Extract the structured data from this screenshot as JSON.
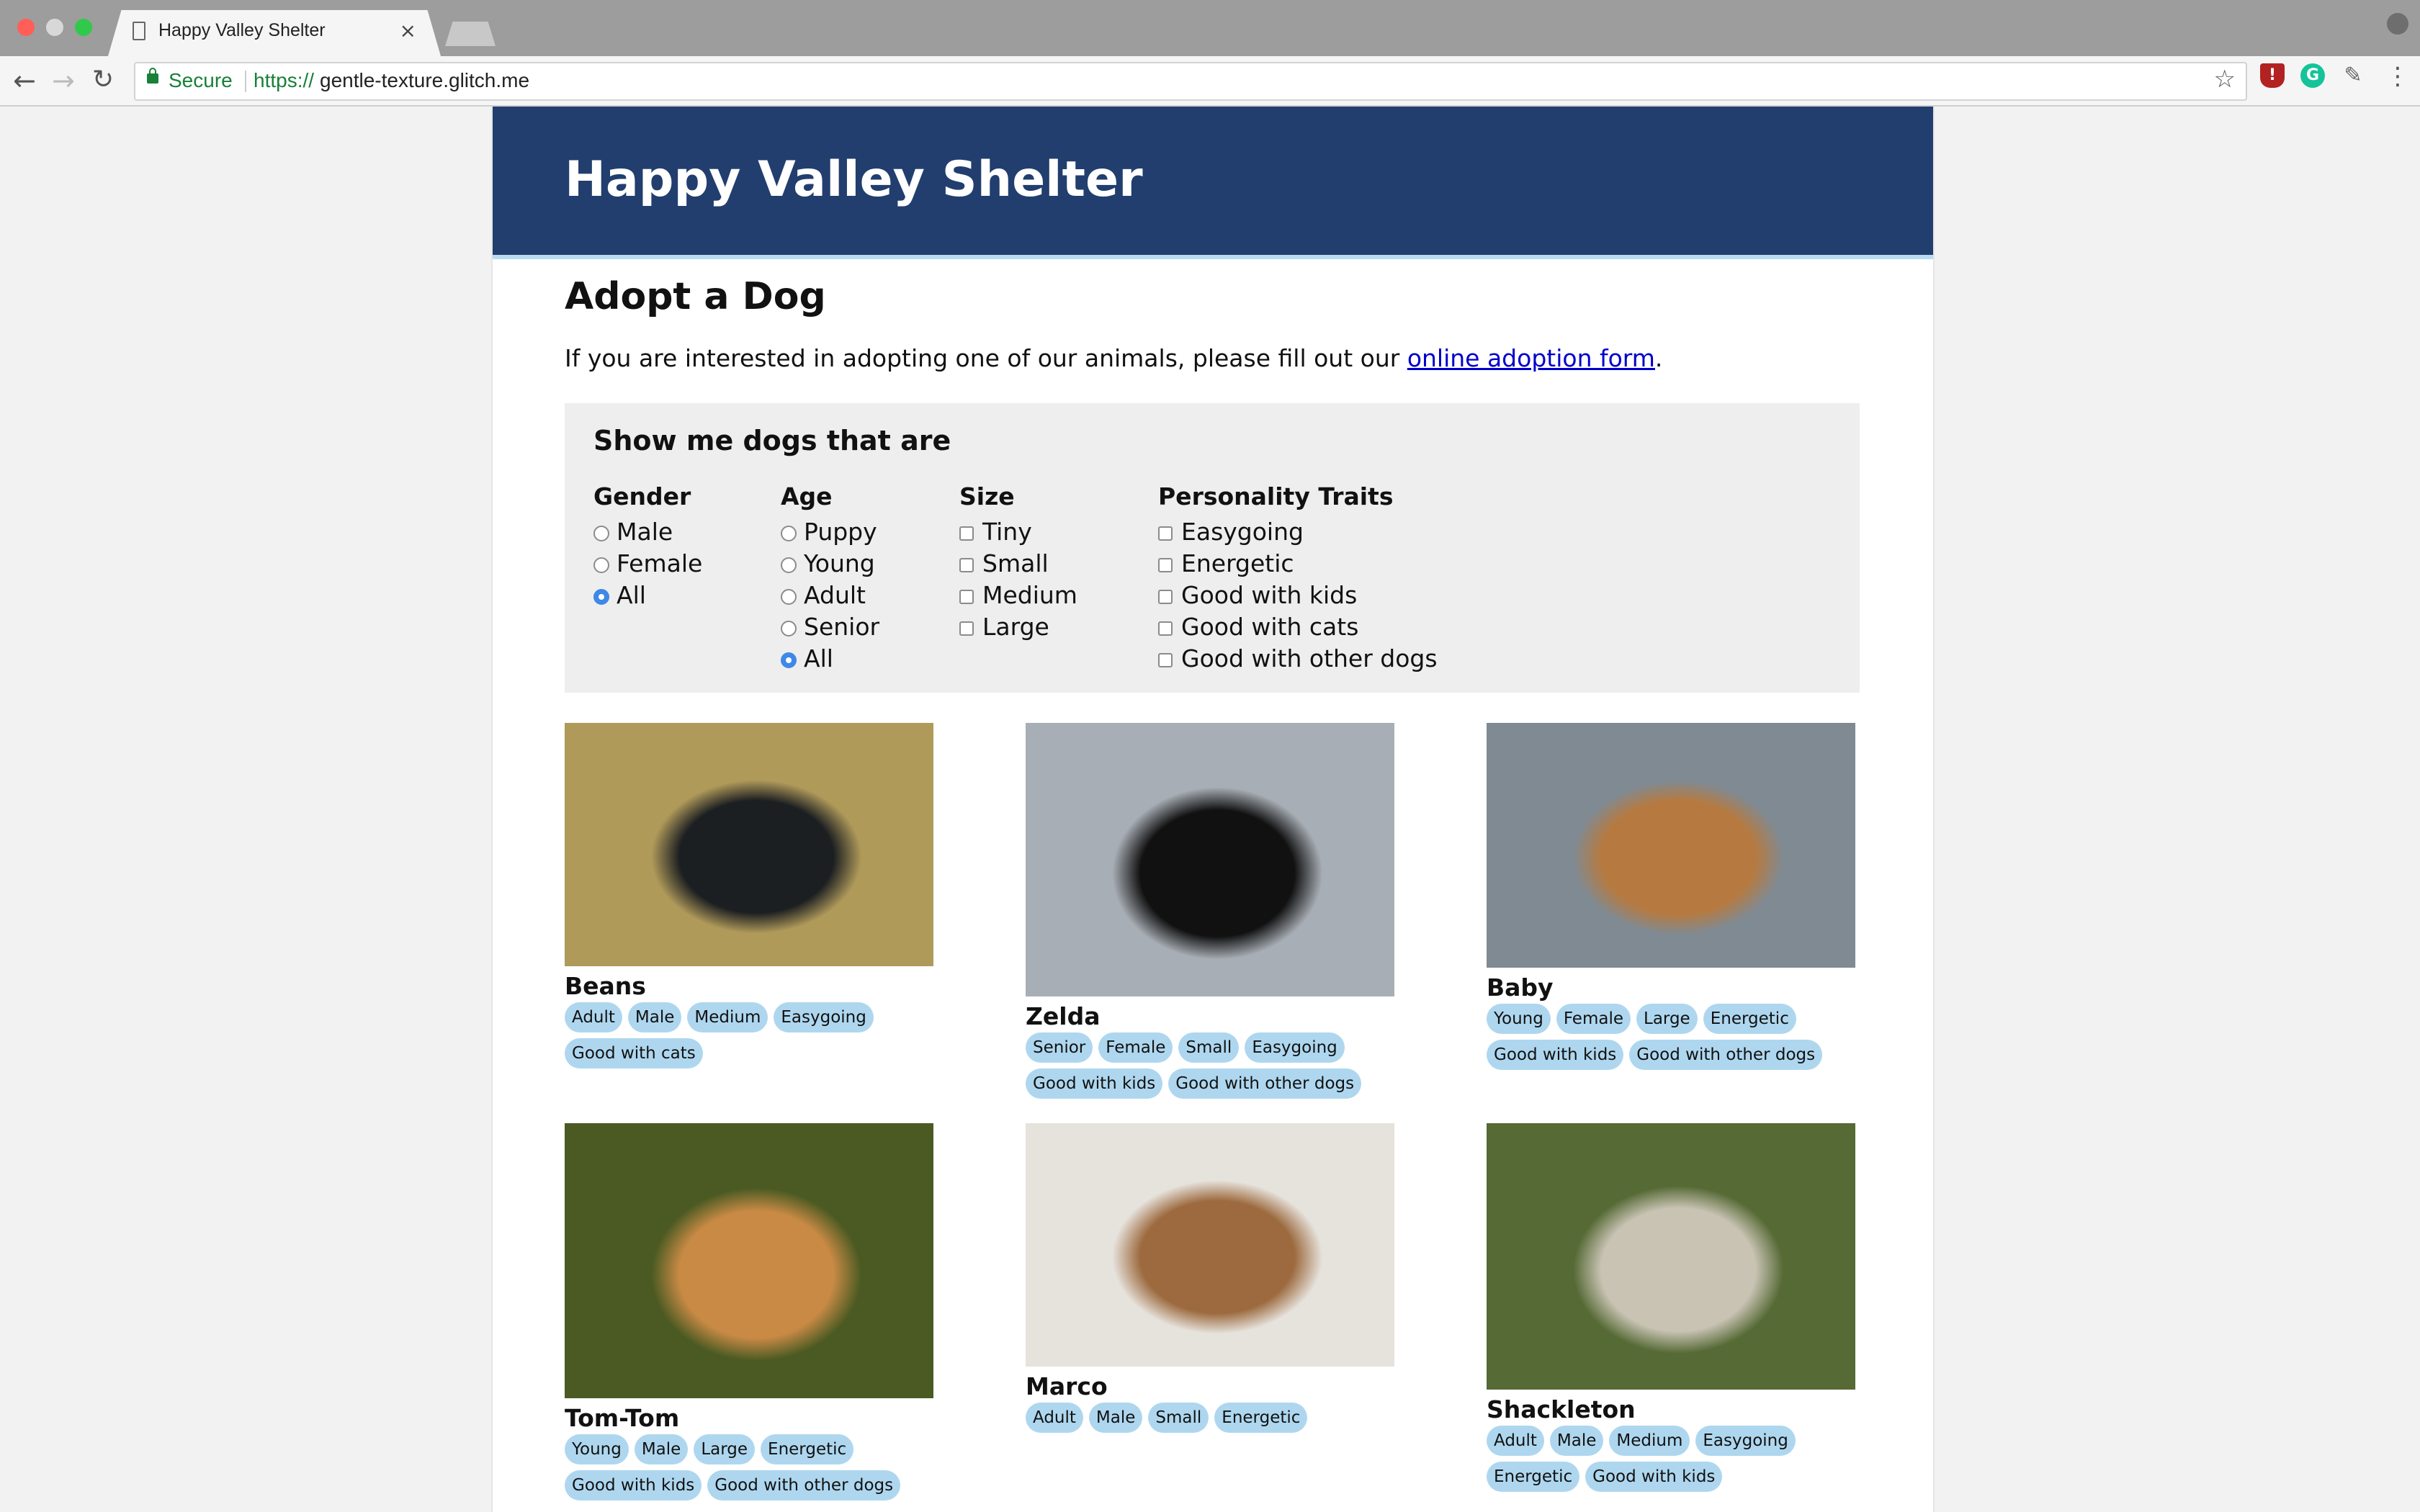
{
  "browser": {
    "tab_title": "Happy Valley Shelter",
    "tab_close": "×",
    "secure_label": "Secure",
    "url_scheme": "https://",
    "url_host": "gentle-texture.glitch.me"
  },
  "site": {
    "title": "Happy Valley Shelter",
    "heading": "Adopt a Dog",
    "intro_before": "If you are interested in adopting one of our animals, please fill out our ",
    "intro_link": "online adoption form",
    "intro_after": "."
  },
  "filters": {
    "title": "Show me dogs that are",
    "gender": {
      "label": "Gender",
      "options": [
        "Male",
        "Female",
        "All"
      ],
      "selected": "All"
    },
    "age": {
      "label": "Age",
      "options": [
        "Puppy",
        "Young",
        "Adult",
        "Senior",
        "All"
      ],
      "selected": "All"
    },
    "size": {
      "label": "Size",
      "options": [
        "Tiny",
        "Small",
        "Medium",
        "Large"
      ]
    },
    "traits": {
      "label": "Personality Traits",
      "options": [
        "Easygoing",
        "Energetic",
        "Good with kids",
        "Good with cats",
        "Good with other dogs"
      ]
    }
  },
  "dogs": [
    {
      "name": "Beans",
      "tags": [
        "Adult",
        "Male",
        "Medium",
        "Easygoing",
        "Good with cats"
      ],
      "photo_colors": [
        "#b09a5a",
        "#1c1f22"
      ]
    },
    {
      "name": "Zelda",
      "tags": [
        "Senior",
        "Female",
        "Small",
        "Easygoing",
        "Good with kids",
        "Good with other dogs"
      ],
      "photo_colors": [
        "#a8aeb5",
        "#111111"
      ]
    },
    {
      "name": "Baby",
      "tags": [
        "Young",
        "Female",
        "Large",
        "Energetic",
        "Good with kids",
        "Good with other dogs"
      ],
      "photo_colors": [
        "#808a92",
        "#b67a40"
      ]
    },
    {
      "name": "Tom-Tom",
      "tags": [
        "Young",
        "Male",
        "Large",
        "Energetic",
        "Good with kids",
        "Good with other dogs"
      ],
      "photo_colors": [
        "#4a5a22",
        "#c98a45"
      ]
    },
    {
      "name": "Marco",
      "tags": [
        "Adult",
        "Male",
        "Small",
        "Energetic"
      ],
      "photo_colors": [
        "#e6e2dc",
        "#9c6a3e"
      ]
    },
    {
      "name": "Shackleton",
      "tags": [
        "Adult",
        "Male",
        "Medium",
        "Easygoing",
        "Energetic",
        "Good with kids"
      ],
      "photo_colors": [
        "#566a35",
        "#c9c3b4"
      ]
    }
  ]
}
